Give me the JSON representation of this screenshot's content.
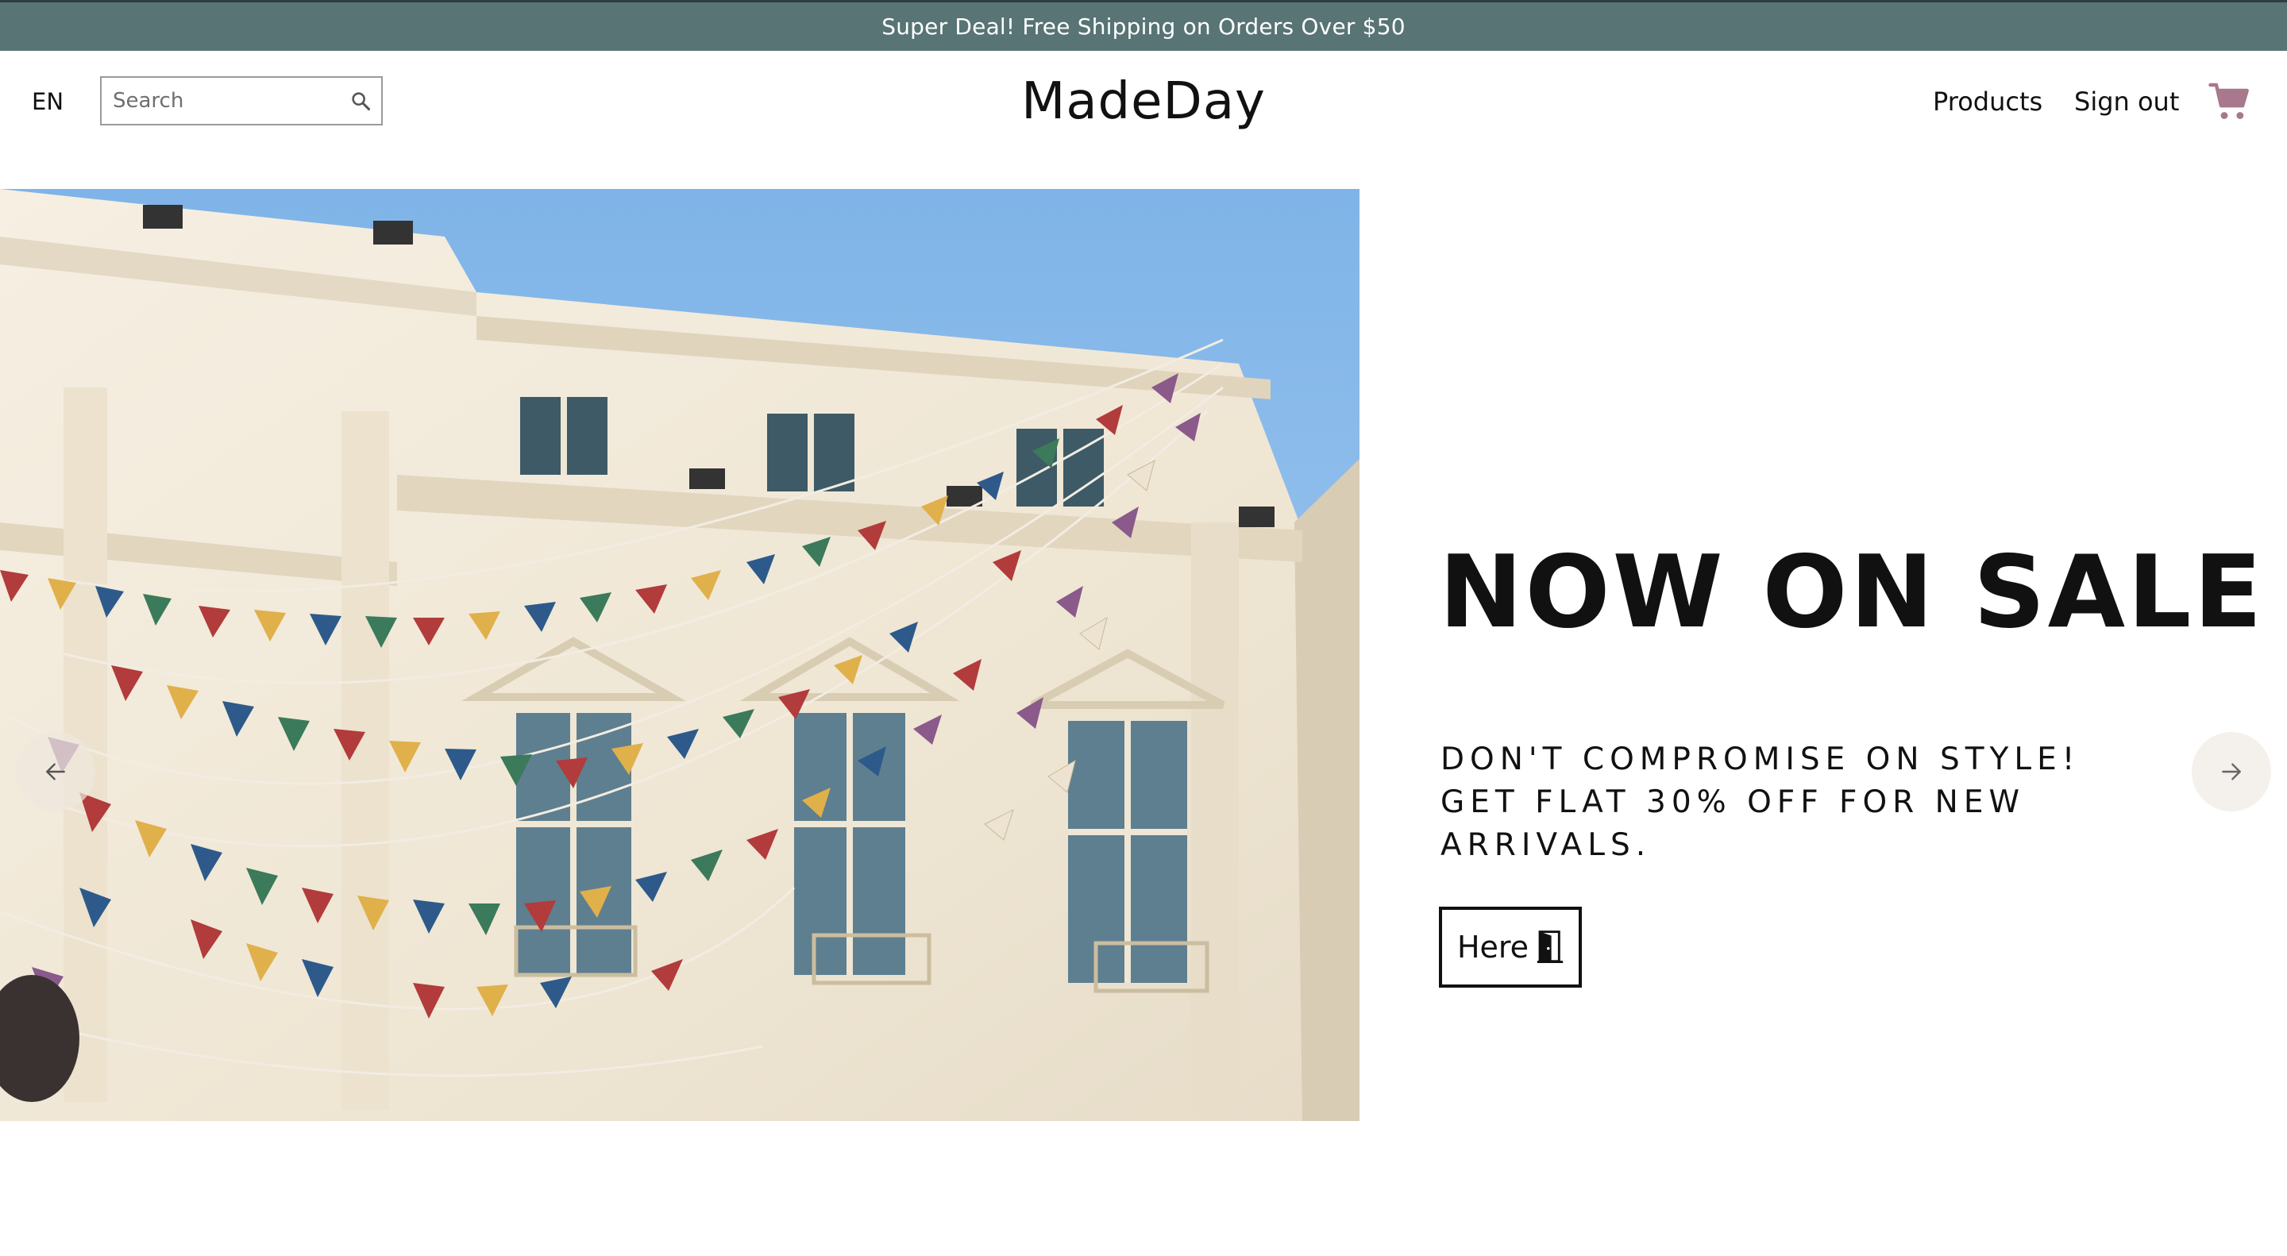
{
  "announcement": {
    "text": "Super Deal! Free Shipping on Orders Over $50"
  },
  "header": {
    "language": "EN",
    "search": {
      "placeholder": "Search",
      "value": "",
      "icon": "search-icon"
    },
    "brand": "MadeDay",
    "nav": {
      "products_label": "Products",
      "signout_label": "Sign out"
    },
    "cart": {
      "icon": "shopping-cart-icon",
      "color": "#a8788c"
    }
  },
  "hero": {
    "image": "building-with-bunting-photo",
    "title": "NOW ON SALE",
    "subtitle": "DON'T COMPROMISE ON STYLE! GET FLAT 30% OFF FOR NEW ARRIVALS.",
    "cta_label": "Here",
    "cta_icon": "door-icon",
    "prev_icon": "arrow-left-icon",
    "next_icon": "arrow-right-icon"
  },
  "colors": {
    "announcement_bg": "#587475",
    "text": "#111111",
    "cart": "#a8788c"
  }
}
